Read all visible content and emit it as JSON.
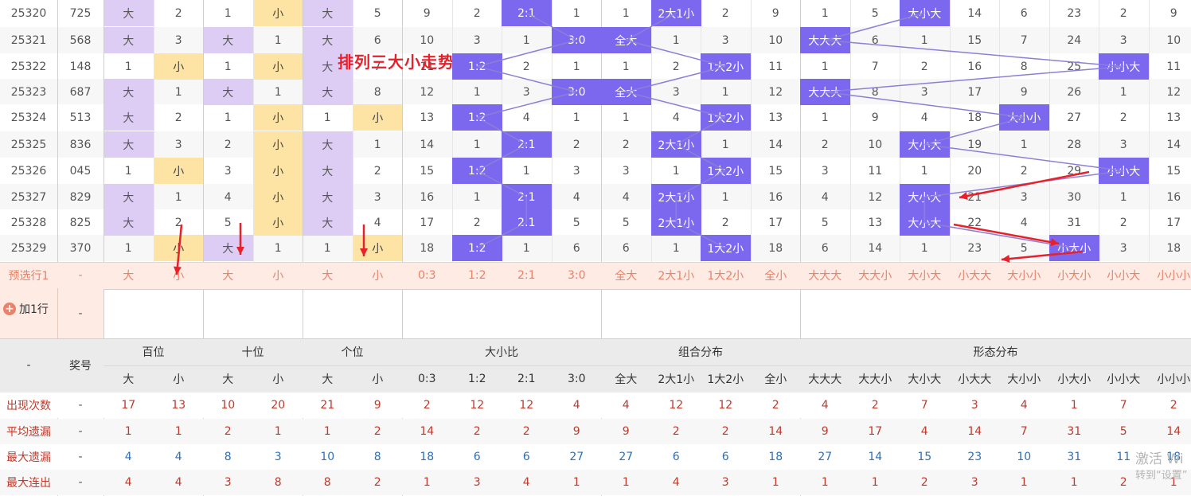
{
  "overlay_title": "排列三大小走势图",
  "watermark": {
    "line1": "激活 Wi",
    "line2": "转到“设置”"
  },
  "add_row": {
    "label": "加1行",
    "dash": "-"
  },
  "column_groups": [
    "百位",
    "十位",
    "个位",
    "大小比",
    "组合分布",
    "形态分布"
  ],
  "award_header": "奖号",
  "dash": "-",
  "sub_headers": [
    "大",
    "小",
    "大",
    "小",
    "大",
    "小",
    "0:3",
    "1:2",
    "2:1",
    "3:0",
    "全大",
    "2大1小",
    "1大2小",
    "全小",
    "大大大",
    "大大小",
    "大小大",
    "小大大",
    "大小小",
    "小大小",
    "小小大",
    "小小小"
  ],
  "draws": [
    {
      "issue": "25320",
      "num": "725",
      "cells": [
        "大",
        2,
        1,
        "小",
        "大",
        5,
        9,
        2,
        "2:1",
        1,
        1,
        "2大1小",
        2,
        9,
        1,
        5,
        "大小大",
        14,
        6,
        23,
        2,
        9
      ]
    },
    {
      "issue": "25321",
      "num": "568",
      "cells": [
        "大",
        3,
        "大",
        1,
        "大",
        6,
        10,
        3,
        1,
        "3:0",
        "全大",
        1,
        3,
        10,
        "大大大",
        6,
        1,
        15,
        7,
        24,
        3,
        10
      ]
    },
    {
      "issue": "25322",
      "num": "148",
      "cells": [
        1,
        "小",
        1,
        "小",
        "大",
        7,
        11,
        "1:2",
        2,
        1,
        1,
        2,
        "1大2小",
        11,
        1,
        7,
        2,
        16,
        8,
        25,
        "小小大",
        11
      ]
    },
    {
      "issue": "25323",
      "num": "687",
      "cells": [
        "大",
        1,
        "大",
        1,
        "大",
        8,
        12,
        1,
        3,
        "3:0",
        "全大",
        3,
        1,
        12,
        "大大大",
        8,
        3,
        17,
        9,
        26,
        1,
        12
      ]
    },
    {
      "issue": "25324",
      "num": "513",
      "cells": [
        "大",
        2,
        1,
        "小",
        1,
        "小",
        13,
        "1:2",
        4,
        1,
        1,
        4,
        "1大2小",
        13,
        1,
        9,
        4,
        18,
        "大小小",
        27,
        2,
        13
      ]
    },
    {
      "issue": "25325",
      "num": "836",
      "cells": [
        "大",
        3,
        2,
        "小",
        "大",
        1,
        14,
        1,
        "2:1",
        2,
        2,
        "2大1小",
        1,
        14,
        2,
        10,
        "大小大",
        19,
        1,
        28,
        3,
        14
      ]
    },
    {
      "issue": "25326",
      "num": "045",
      "cells": [
        1,
        "小",
        3,
        "小",
        "大",
        2,
        15,
        "1:2",
        1,
        3,
        3,
        1,
        "1大2小",
        15,
        3,
        11,
        1,
        20,
        2,
        29,
        "小小大",
        15
      ]
    },
    {
      "issue": "25327",
      "num": "829",
      "cells": [
        "大",
        1,
        4,
        "小",
        "大",
        3,
        16,
        1,
        "2:1",
        4,
        4,
        "2大1小",
        1,
        16,
        4,
        12,
        "大小大",
        21,
        3,
        30,
        1,
        16
      ]
    },
    {
      "issue": "25328",
      "num": "825",
      "cells": [
        "大",
        2,
        5,
        "小",
        "大",
        4,
        17,
        2,
        "2:1",
        5,
        5,
        "2大1小",
        2,
        17,
        5,
        13,
        "大小大",
        22,
        4,
        31,
        2,
        17
      ]
    },
    {
      "issue": "25329",
      "num": "370",
      "cells": [
        1,
        "小",
        "大",
        1,
        1,
        "小",
        18,
        "1:2",
        1,
        6,
        6,
        1,
        "1大2小",
        18,
        6,
        14,
        1,
        23,
        5,
        "小大小",
        3,
        18
      ]
    }
  ],
  "preselect_row": {
    "label": "预选行1",
    "num": "-",
    "cells": [
      "大",
      "小",
      "大",
      "小",
      "大",
      "小",
      "0:3",
      "1:2",
      "2:1",
      "3:0",
      "全大",
      "2大1小",
      "1大2小",
      "全小",
      "大大大",
      "大大小",
      "大小大",
      "小大大",
      "大小小",
      "小大小",
      "小小大",
      "小小小"
    ]
  },
  "stats": [
    {
      "label": "出现次数",
      "num": "-",
      "color": "red",
      "values": [
        17,
        13,
        10,
        20,
        21,
        9,
        2,
        12,
        12,
        4,
        4,
        12,
        12,
        2,
        4,
        2,
        7,
        3,
        4,
        1,
        7,
        2
      ]
    },
    {
      "label": "平均遗漏",
      "num": "-",
      "color": "red",
      "values": [
        1,
        1,
        2,
        1,
        1,
        2,
        14,
        2,
        2,
        9,
        9,
        2,
        2,
        14,
        9,
        17,
        4,
        14,
        7,
        31,
        5,
        14
      ]
    },
    {
      "label": "最大遗漏",
      "num": "-",
      "color": "blue",
      "values": [
        4,
        4,
        8,
        3,
        10,
        8,
        18,
        6,
        6,
        27,
        27,
        6,
        6,
        18,
        27,
        14,
        15,
        23,
        10,
        31,
        11,
        18
      ]
    },
    {
      "label": "最大连出",
      "num": "-",
      "color": "red",
      "values": [
        4,
        4,
        3,
        8,
        8,
        2,
        1,
        3,
        4,
        1,
        1,
        4,
        3,
        1,
        1,
        1,
        2,
        3,
        1,
        1,
        2,
        1
      ]
    }
  ],
  "colors": {
    "hit": "#7b68ee",
    "purple": "#ddcdf5",
    "yellow": "#fde4a5",
    "line": "#8c7fd6",
    "arrow": "#e8202a",
    "preselect_bg": "#fdebe4",
    "header_bg": "#ebebeb"
  }
}
